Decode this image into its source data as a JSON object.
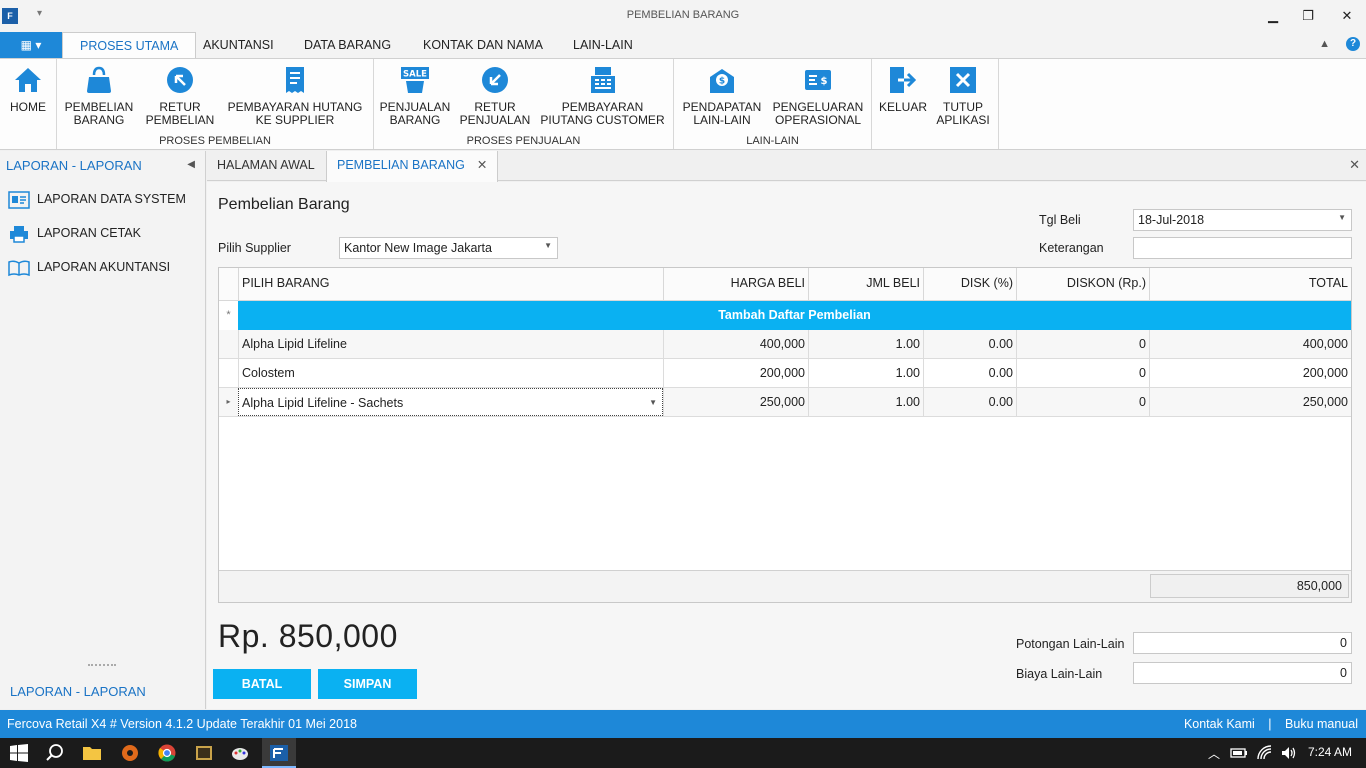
{
  "window": {
    "title": "PEMBELIAN BARANG",
    "min": "▁",
    "max": "❐",
    "close": "✕",
    "app_icon": "F",
    "qa_arrow": "▾"
  },
  "ribbon": {
    "file_label": "▦ ▾",
    "tabs": [
      "PROSES UTAMA",
      "AKUNTANSI",
      "DATA BARANG",
      "KONTAK DAN NAMA",
      "LAIN-LAIN"
    ],
    "collapse_icon": "▲",
    "help_icon": "?",
    "groups": [
      {
        "label": ""
      },
      {
        "label": "PROSES PEMBELIAN"
      },
      {
        "label": "PROSES PENJUALAN"
      },
      {
        "label": "LAIN-LAIN"
      },
      {
        "label": ""
      }
    ],
    "buttons": {
      "home": [
        "HOME",
        ""
      ],
      "pembelian": [
        "PEMBELIAN",
        "BARANG"
      ],
      "retur_pembelian": [
        "RETUR",
        "PEMBELIAN"
      ],
      "bayar_hutang": [
        "PEMBAYARAN HUTANG",
        "KE SUPPLIER"
      ],
      "penjualan": [
        "PENJUALAN",
        "BARANG"
      ],
      "retur_penjualan": [
        "RETUR",
        "PENJUALAN"
      ],
      "bayar_piutang": [
        "PEMBAYARAN",
        "PIUTANG CUSTOMER"
      ],
      "pendapatan": [
        "PENDAPATAN",
        "LAIN-LAIN"
      ],
      "pengeluaran": [
        "PENGELUARAN",
        "OPERASIONAL"
      ],
      "keluar": [
        "KELUAR",
        ""
      ],
      "tutup": [
        "TUTUP",
        "APLIKASI"
      ]
    },
    "sale_badge": "SALE"
  },
  "sidebar": {
    "header": "LAPORAN - LAPORAN",
    "collapse_icon": "◀",
    "items": [
      "LAPORAN DATA SYSTEM",
      "LAPORAN CETAK",
      "LAPORAN AKUNTANSI"
    ],
    "footer": "LAPORAN - LAPORAN"
  },
  "doctabs": {
    "tabs": [
      "HALAMAN AWAL",
      "PEMBELIAN BARANG"
    ],
    "tab_close": "✕",
    "close_all": "✕"
  },
  "form": {
    "title": "Pembelian Barang",
    "supplier_label": "Pilih Supplier",
    "supplier_value": "Kantor New Image Jakarta",
    "tgl_label": "Tgl Beli",
    "tgl_value": "18-Jul-2018",
    "keterangan_label": "Keterangan",
    "keterangan_value": "",
    "dd_icon": "▼"
  },
  "grid": {
    "columns": [
      "PILIH BARANG",
      "HARGA BELI",
      "JML BELI",
      "DISK (%)",
      "DISKON (Rp.)",
      "TOTAL"
    ],
    "add_row_label": "Tambah Daftar Pembelian",
    "add_row_marker": "*",
    "current_marker": "▸",
    "rows": [
      [
        "Alpha Lipid Lifeline",
        "400,000",
        "1.00",
        "0.00",
        "0",
        "400,000"
      ],
      [
        "Colostem",
        "200,000",
        "1.00",
        "0.00",
        "0",
        "200,000"
      ],
      [
        "Alpha Lipid Lifeline - Sachets",
        "250,000",
        "1.00",
        "0.00",
        "0",
        "250,000"
      ]
    ],
    "sum_total": "850,000"
  },
  "summary": {
    "grand_total": "Rp. 850,000",
    "potongan_label": "Potongan Lain-Lain",
    "potongan_value": "0",
    "biaya_label": "Biaya Lain-Lain",
    "biaya_value": "0",
    "batal_label": "BATAL",
    "simpan_label": "SIMPAN"
  },
  "statusbar": {
    "version": "Fercova Retail X4 # Version 4.1.2 Update Terakhir 01 Mei 2018",
    "kontak": "Kontak Kami",
    "sep": "|",
    "manual": "Buku manual"
  },
  "taskbar": {
    "time": "7:24 AM",
    "tray_up": "︿"
  }
}
